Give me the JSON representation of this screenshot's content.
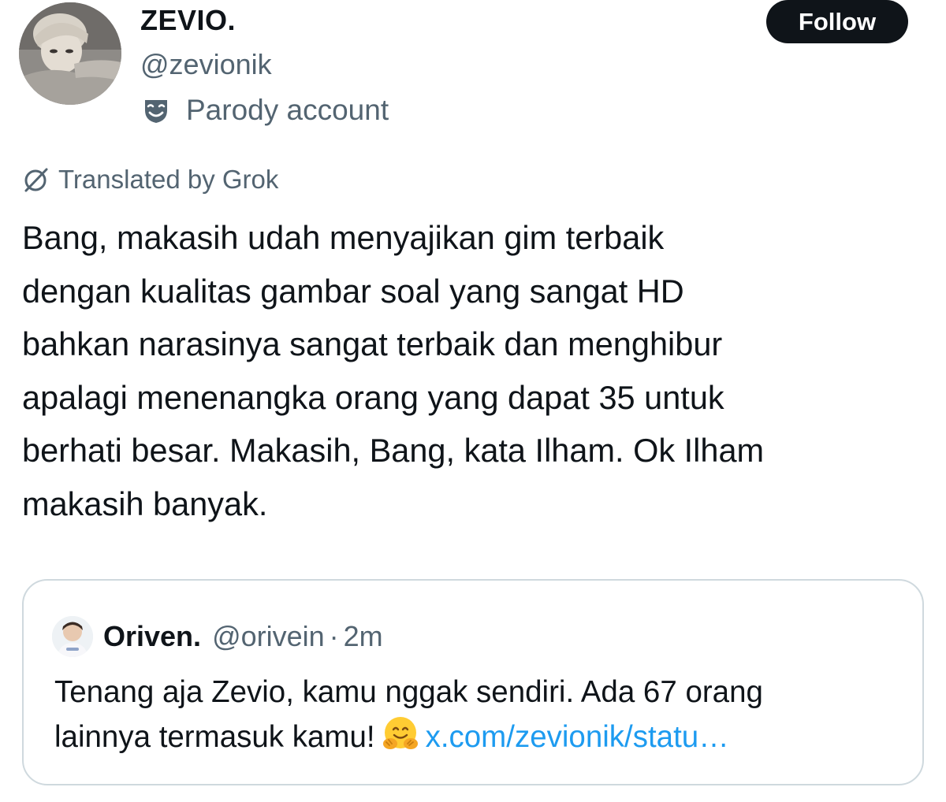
{
  "author": {
    "display_name": "ZEVIO.",
    "handle": "@zevionik",
    "account_label": "Parody account",
    "account_label_icon": "theater-mask-icon"
  },
  "follow_button": {
    "label": "Follow"
  },
  "translation": {
    "label": "Translated by Grok",
    "icon": "grok-icon"
  },
  "tweet": {
    "lines": [
      "Bang, makasih udah menyajikan gim terbaik",
      "dengan kualitas gambar soal yang sangat HD",
      "bahkan narasinya sangat terbaik dan menghibur",
      "apalagi menenangka orang yang dapat 35 untuk",
      "berhati besar. Makasih, Bang, kata Ilham. Ok Ilham",
      "makasih banyak."
    ]
  },
  "quote": {
    "display_name": "Oriven.",
    "handle": "@orivein",
    "separator": "·",
    "time": "2m",
    "text_line1": "Tenang aja Zevio, kamu nggak sendiri. Ada 67 orang",
    "text_line2": "lainnya termasuk kamu!",
    "emoji": "hugging-face-emoji",
    "link": "x.com/zevionik/statu…"
  },
  "colors": {
    "text_primary": "#0f1419",
    "text_secondary": "#536471",
    "link": "#1d9bf0",
    "border": "#cfd9de",
    "button_bg": "#0f1419",
    "button_text": "#ffffff"
  }
}
